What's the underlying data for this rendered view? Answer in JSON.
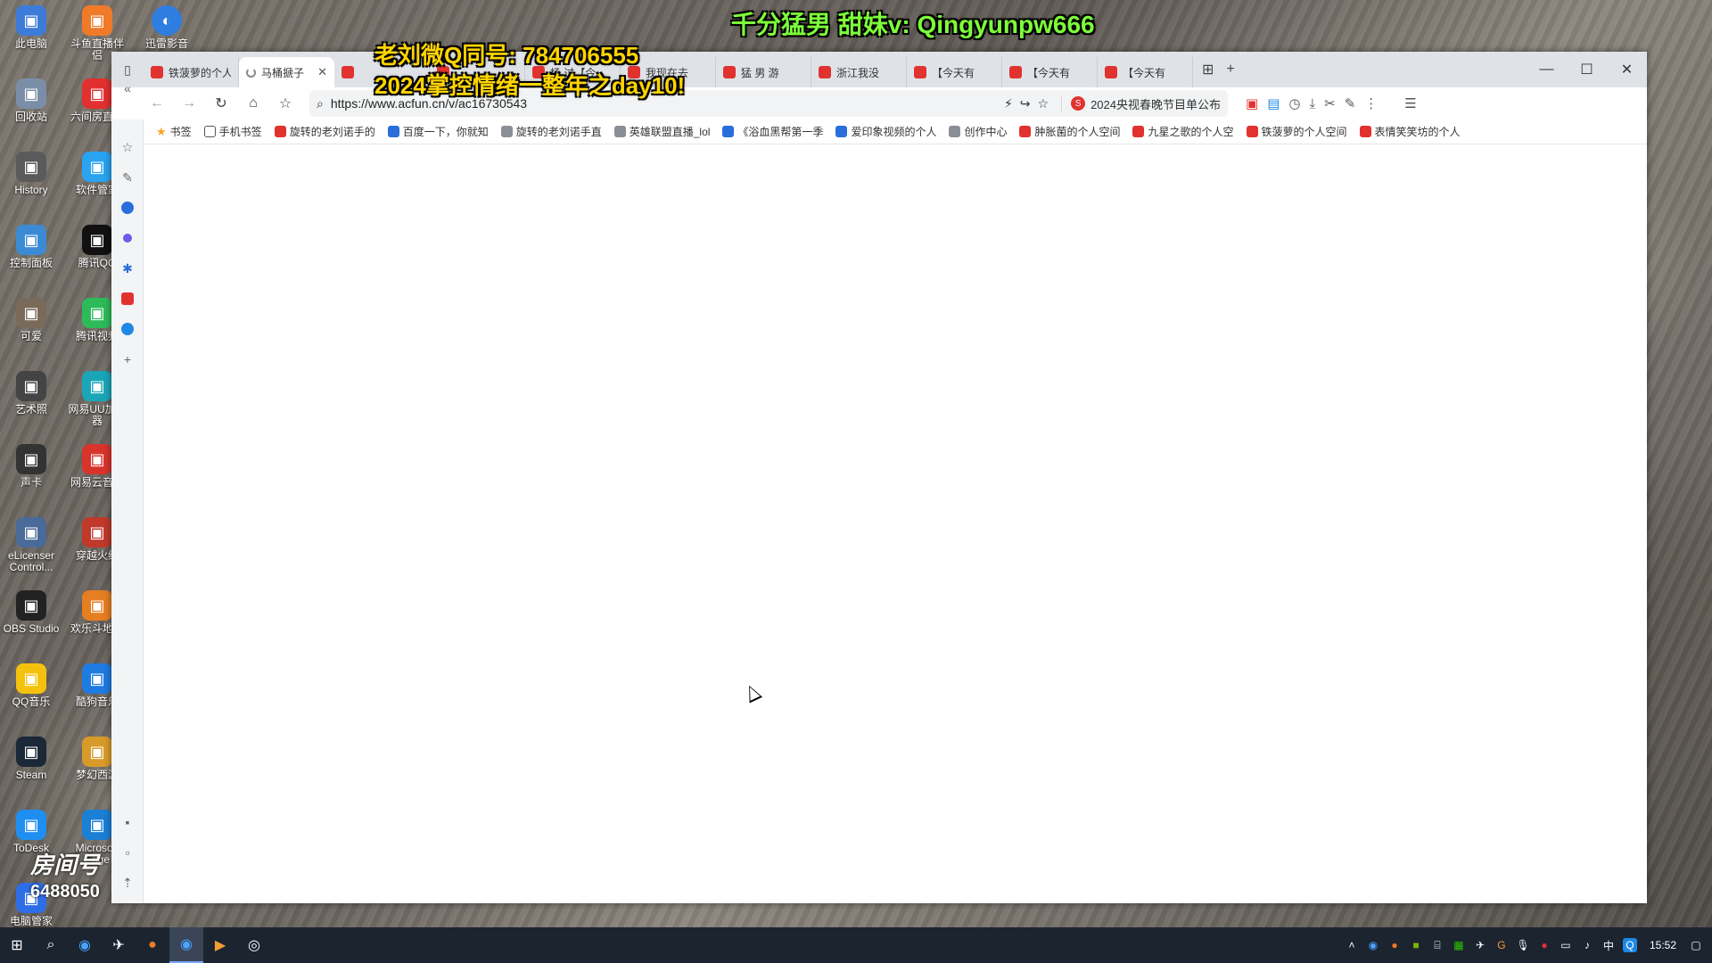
{
  "overlay": {
    "top_text": "千分猛男 甜妹v: Qingyunpw666",
    "qq_text": "老刘微Q同号: 784706555",
    "year_text": "2024掌控情绪一整年之day10!"
  },
  "desktop_icons": [
    {
      "label": "此电脑",
      "icon": "computer-icon",
      "color": "#3d7bd9"
    },
    {
      "label": "斗鱼直播伴侣",
      "icon": "douyu-icon",
      "color": "#f07a28"
    },
    {
      "label": "迅雷影音",
      "icon": "player-icon",
      "color": "#2f7de1"
    },
    {
      "label": "回收站",
      "icon": "recycle-bin-icon",
      "color": "#7a8ea8"
    },
    {
      "label": "六间房直播",
      "icon": "six-icon",
      "color": "#e23030"
    },
    {
      "label": "History",
      "icon": "history-icon",
      "color": "#5a5a5a"
    },
    {
      "label": "软件管家",
      "icon": "software-icon",
      "color": "#2aa3f0"
    },
    {
      "label": "控制面板",
      "icon": "control-panel-icon",
      "color": "#3b8bd4"
    },
    {
      "label": "腾讯QQ",
      "icon": "qq-icon",
      "color": "#111111"
    },
    {
      "label": "可爱",
      "icon": "folder-icon",
      "color": "#7a6a5a"
    },
    {
      "label": "腾讯视频",
      "icon": "video-icon",
      "color": "#2dbb5a"
    },
    {
      "label": "艺术照",
      "icon": "photo-icon",
      "color": "#444444"
    },
    {
      "label": "网易UU加速器",
      "icon": "uu-icon",
      "color": "#1aa6b7"
    },
    {
      "label": "声卡",
      "icon": "soundcard-icon",
      "color": "#333333"
    },
    {
      "label": "网易云音乐",
      "icon": "music-icon",
      "color": "#d8342c"
    },
    {
      "label": "eLicenser Control...",
      "icon": "elicenser-icon",
      "color": "#4a6a9a"
    },
    {
      "label": "穿越火线",
      "icon": "cf-icon",
      "color": "#c0392b"
    },
    {
      "label": "OBS Studio",
      "icon": "obs-icon",
      "color": "#222222"
    },
    {
      "label": "欢乐斗地主",
      "icon": "game-icon",
      "color": "#e67e22"
    },
    {
      "label": "QQ音乐",
      "icon": "qqmusic-icon",
      "color": "#f4c20d"
    },
    {
      "label": "酷狗音乐",
      "icon": "kugou-icon",
      "color": "#1e7be0"
    },
    {
      "label": "Steam",
      "icon": "steam-icon",
      "color": "#1b2838"
    },
    {
      "label": "梦幻西游",
      "icon": "mhxy-icon",
      "color": "#d89b2a"
    },
    {
      "label": "ToDesk",
      "icon": "todesk-icon",
      "color": "#1f8ef1"
    },
    {
      "label": "Microsoft Edge",
      "icon": "edge-icon",
      "color": "#1b7fd6"
    },
    {
      "label": "电脑管家",
      "icon": "pc-manager-icon",
      "color": "#2d6ee6"
    }
  ],
  "browser": {
    "tabs": [
      {
        "label": "铁菠萝的个人",
        "active": false
      },
      {
        "label": "马桶搋子",
        "active": true
      },
      {
        "label": "",
        "active": false
      },
      {
        "label": "",
        "active": false
      },
      {
        "label": "杨 过【今",
        "active": false
      },
      {
        "label": "我现在去",
        "active": false
      },
      {
        "label": "猛 男 游",
        "active": false
      },
      {
        "label": "浙江我没",
        "active": false
      },
      {
        "label": "【今天有",
        "active": false
      },
      {
        "label": "【今天有",
        "active": false
      },
      {
        "label": "【今天有",
        "active": false
      }
    ],
    "url": "https://www.acfun.cn/v/ac16730543",
    "hot_search": "2024央视春晚节目单公布",
    "bookmarks": [
      {
        "label": "书签",
        "type": "star"
      },
      {
        "label": "手机书签",
        "type": "outline"
      },
      {
        "label": "旋转的老刘诺手的",
        "type": "red"
      },
      {
        "label": "百度一下，你就知",
        "type": "blue"
      },
      {
        "label": "旋转的老刘诺手直",
        "type": "grey"
      },
      {
        "label": "英雄联盟直播_lol",
        "type": "grey"
      },
      {
        "label": "《浴血黑帮第一季",
        "type": "blue"
      },
      {
        "label": "爱印象视频的个人",
        "type": "blue"
      },
      {
        "label": "创作中心",
        "type": "grey"
      },
      {
        "label": "肿胀菌的个人空间",
        "type": "red"
      },
      {
        "label": "九星之歌的个人空",
        "type": "red"
      },
      {
        "label": "铁菠萝的个人空间",
        "type": "red"
      },
      {
        "label": "表情笑笑坊的个人",
        "type": "red"
      }
    ]
  },
  "watermark": {
    "room_label": "房间号",
    "room_id": "6488050"
  },
  "taskbar": {
    "time": "15:52",
    "ime": "中"
  }
}
